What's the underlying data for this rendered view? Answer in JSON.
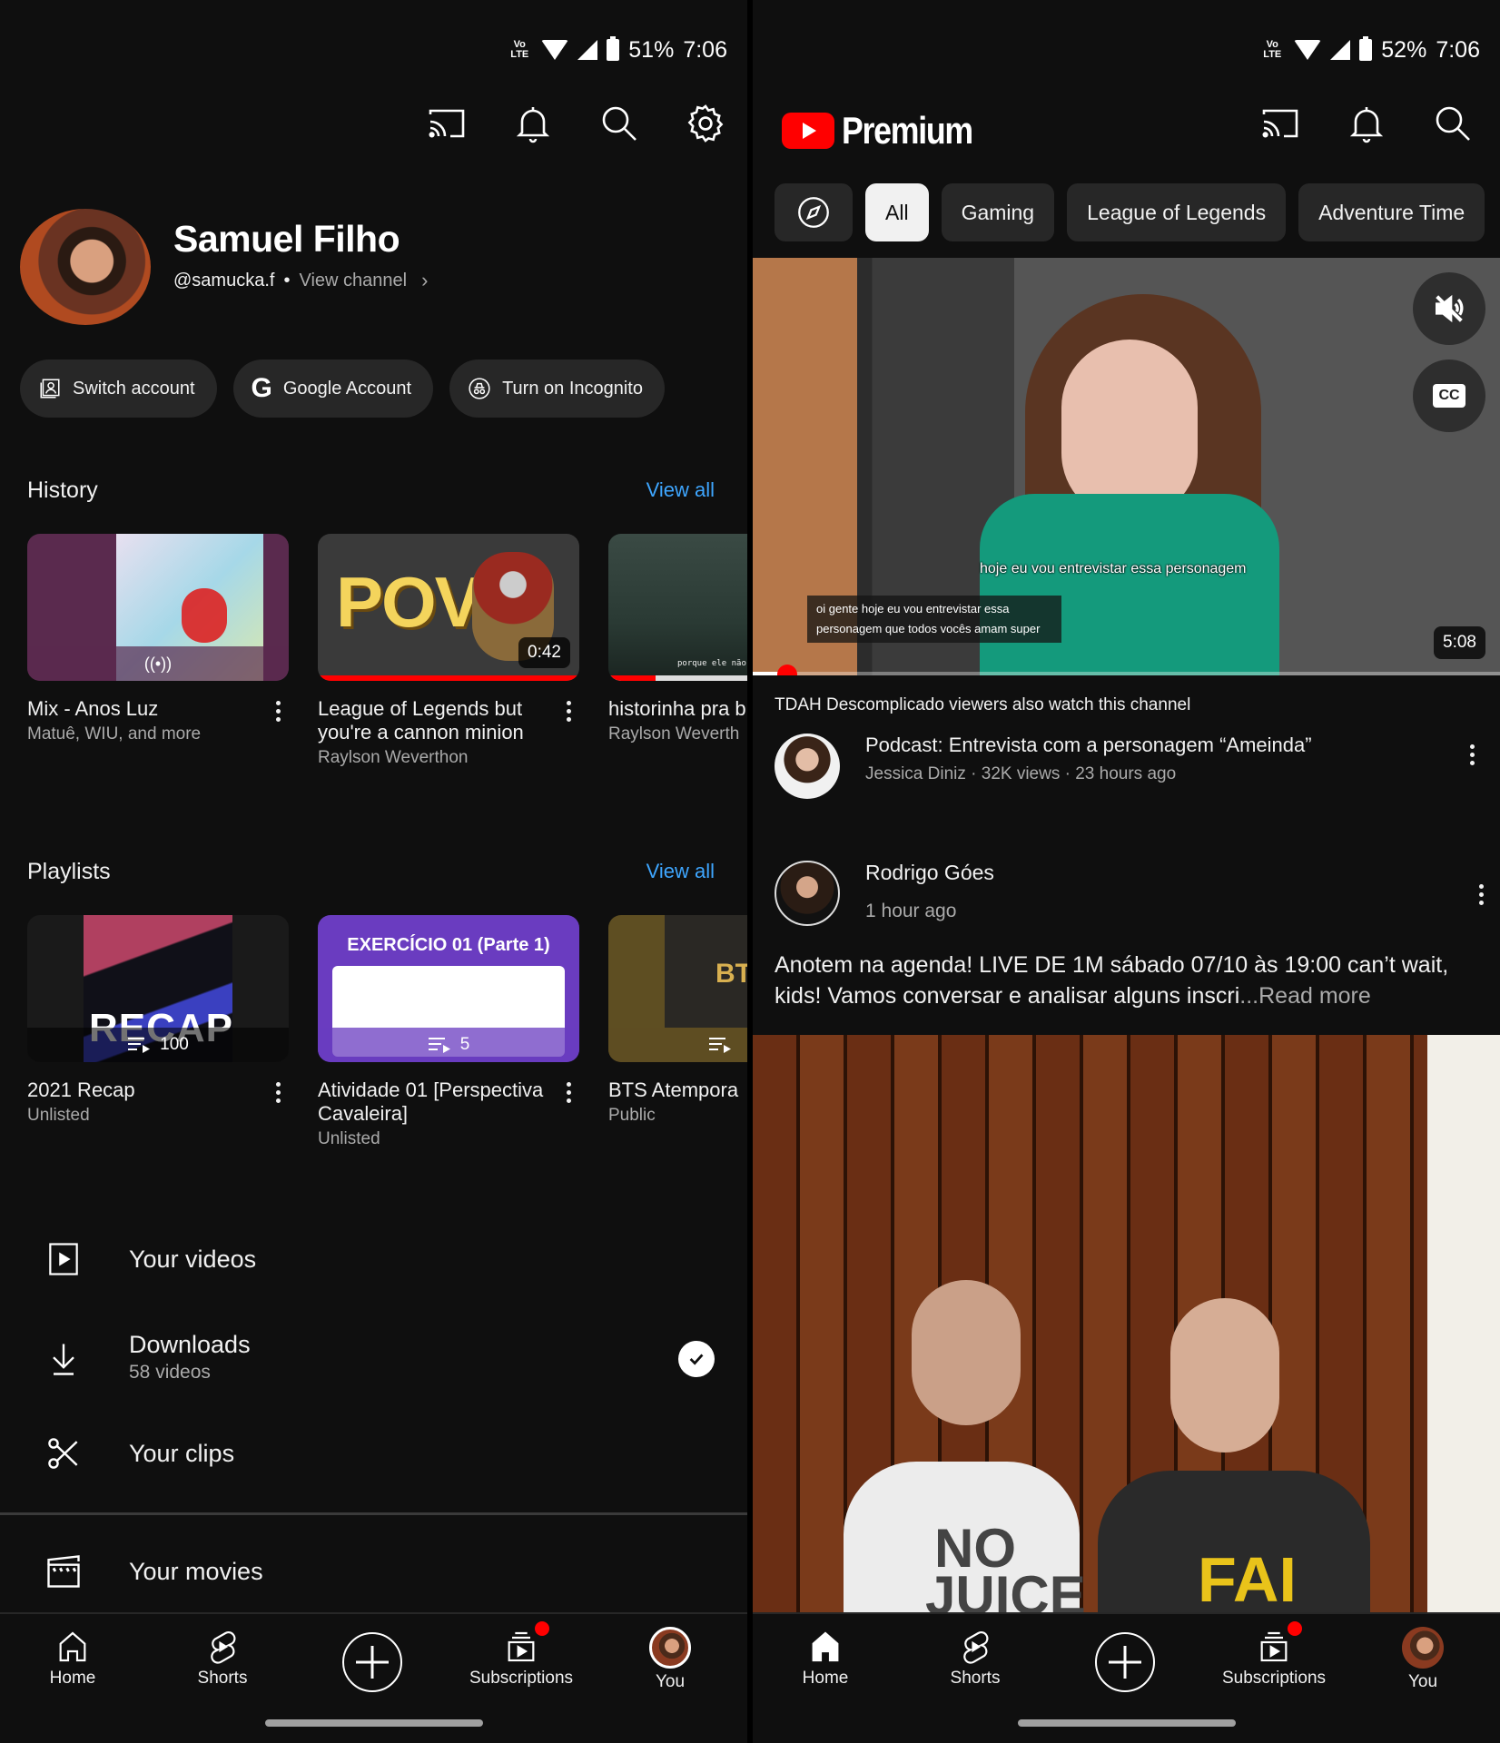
{
  "left": {
    "status_bar": {
      "network": "VoLTE",
      "battery": "51%",
      "time": "7:06"
    },
    "top_icons": [
      "cast-icon",
      "bell-icon",
      "search-icon",
      "gear-icon"
    ],
    "profile": {
      "name": "Samuel Filho",
      "handle": "@samucka.f",
      "separator": "•",
      "view_channel": "View channel"
    },
    "account_chips": [
      {
        "label": "Switch account",
        "icon": "switch-account-icon"
      },
      {
        "label": "Google Account",
        "icon": "google-icon"
      },
      {
        "label": "Turn on Incognito",
        "icon": "incognito-icon"
      }
    ],
    "history": {
      "title": "History",
      "view_all": "View all",
      "items": [
        {
          "title": "Mix - Anos Luz",
          "subtitle": "Matuê, WIU, and more",
          "thumb_color": "#5a2a4e"
        },
        {
          "title": "League of Legends but you're a cannon minion",
          "subtitle": "Raylson Weverthon",
          "duration": "0:42",
          "progress": 1.0,
          "thumb_text": "POV"
        },
        {
          "title": "historinha pra b",
          "subtitle": "Raylson Weverth",
          "progress": 0.18,
          "thumb_caption": "porque ele não s"
        }
      ]
    },
    "playlists": {
      "title": "Playlists",
      "view_all": "View all",
      "items": [
        {
          "title": "2021 Recap",
          "subtitle": "Unlisted",
          "count": "100",
          "thumb_text": "RECAP"
        },
        {
          "title": "Atividade 01 [Perspectiva Cavaleira]",
          "subtitle": "Unlisted",
          "count": "5",
          "thumb_text": "EXERCÍCIO 01 (Parte 1)"
        },
        {
          "title": "BTS Atempora",
          "subtitle": "Public",
          "count": "",
          "thumb_text": "BT"
        }
      ]
    },
    "menu": [
      {
        "label": "Your videos",
        "icon": "play-square-icon"
      },
      {
        "label": "Downloads",
        "sub": "58 videos",
        "icon": "download-icon",
        "status": "downloaded"
      },
      {
        "label": "Your clips",
        "icon": "scissors-icon"
      },
      {
        "label": "Your movies",
        "icon": "clapperboard-icon"
      }
    ],
    "bottom_nav": [
      {
        "label": "Home",
        "icon": "home-icon",
        "active": false
      },
      {
        "label": "Shorts",
        "icon": "shorts-icon"
      },
      {
        "label": "",
        "icon": "create-icon"
      },
      {
        "label": "Subscriptions",
        "icon": "subscriptions-icon",
        "badge": true
      },
      {
        "label": "You",
        "icon": "avatar",
        "active": true
      }
    ]
  },
  "right": {
    "status_bar": {
      "network": "VoLTE",
      "battery": "52%",
      "time": "7:06"
    },
    "logo_text": "Premium",
    "top_icons": [
      "cast-icon",
      "bell-icon",
      "search-icon"
    ],
    "filters": [
      {
        "label": "",
        "icon": "compass-icon"
      },
      {
        "label": "All",
        "active": true
      },
      {
        "label": "Gaming"
      },
      {
        "label": "League of Legends"
      },
      {
        "label": "Adventure Time"
      }
    ],
    "video": {
      "caption_main": "hoje eu vou entrevistar essa personagem",
      "caption_box_line1": "oi gente hoje eu vou entrevistar essa",
      "caption_box_line2": "personagem que todos vocês amam super",
      "duration": "5:08",
      "progress": 0.04,
      "muted": true,
      "cc": "CC"
    },
    "also_watch": "TDAH Descomplicado viewers also watch this channel",
    "recommendation": {
      "title": "Podcast: Entrevista com a personagem “Ameinda”",
      "meta": "Jessica Diniz · 32K views · 23 hours ago"
    },
    "post": {
      "author": "Rodrigo Góes",
      "time": "1 hour ago",
      "text": "Anotem na agenda! LIVE DE 1M sábado 07/10 às 19:00 can’t wait, kids! Vamos conversar e analisar alguns inscri",
      "ellipsis": "...",
      "read_more": "Read more",
      "image_shirt_text": "NO JUICE",
      "image_shirt_text2": "FAI"
    },
    "bottom_nav": [
      {
        "label": "Home",
        "icon": "home-icon",
        "active": true
      },
      {
        "label": "Shorts",
        "icon": "shorts-icon"
      },
      {
        "label": "",
        "icon": "create-icon"
      },
      {
        "label": "Subscriptions",
        "icon": "subscriptions-icon",
        "badge": true
      },
      {
        "label": "You",
        "icon": "avatar"
      }
    ]
  },
  "colors": {
    "accent_red": "#ff0000",
    "link_blue": "#3ea6ff",
    "background": "#0f0f0f",
    "chip": "#272727"
  }
}
